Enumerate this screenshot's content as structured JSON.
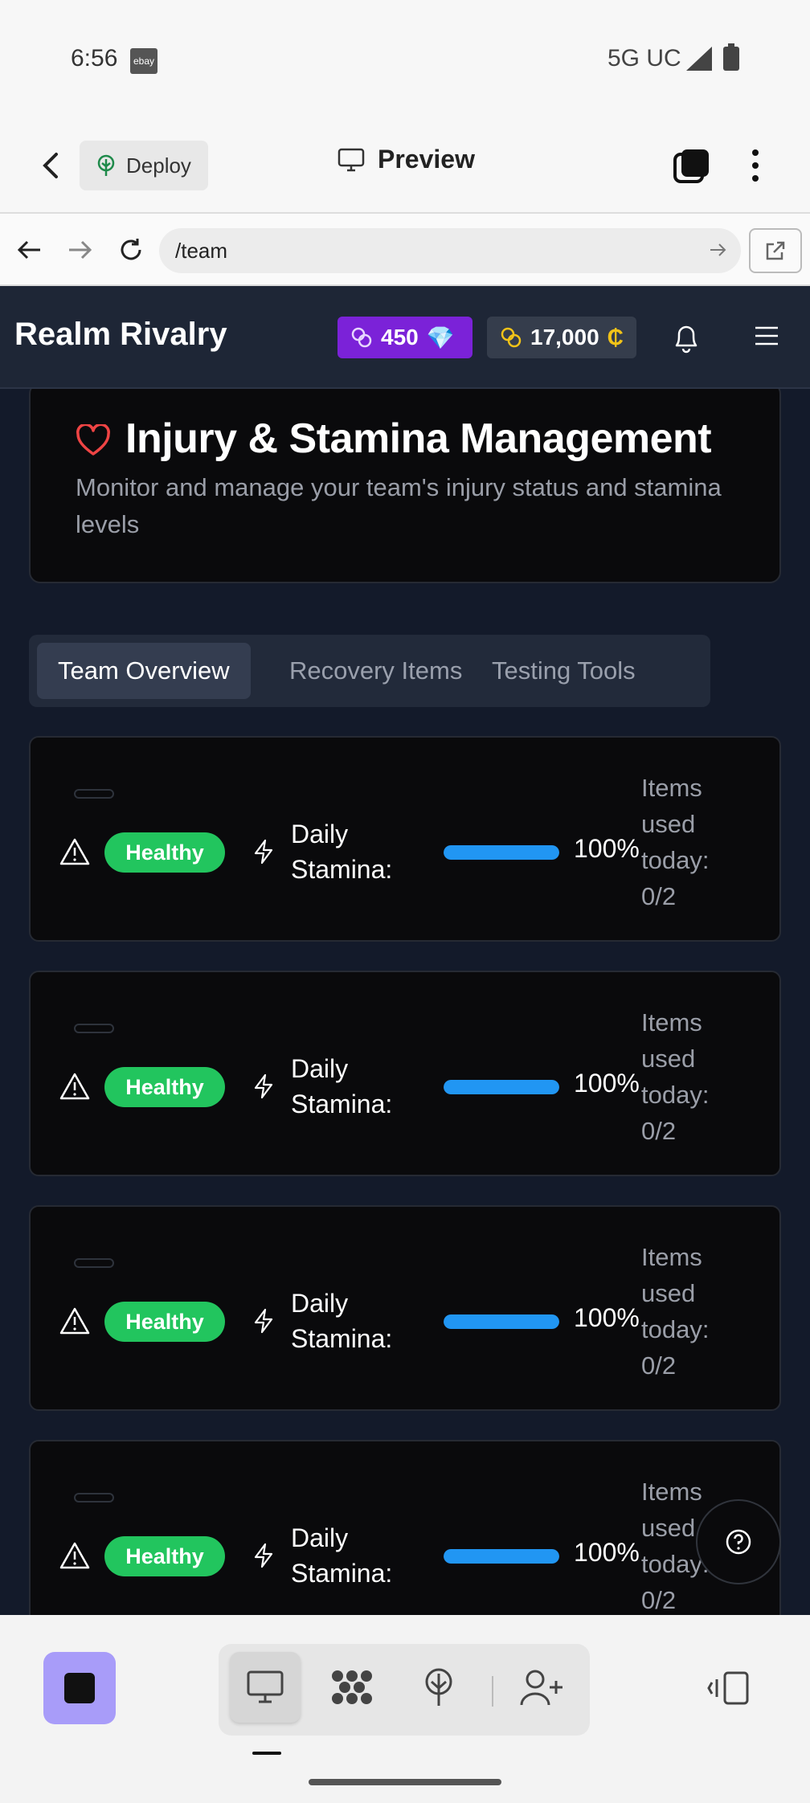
{
  "statusbar": {
    "time": "6:56",
    "app_badge": "ebay",
    "network": "5G UC"
  },
  "app_header": {
    "deploy_label": "Deploy",
    "preview_label": "Preview"
  },
  "url_bar": {
    "url": "/team"
  },
  "game": {
    "brand": "Realm Rivalry",
    "gems": "450",
    "gem_emoji": "💎",
    "credits": "17,000",
    "currency_symbol": "₵"
  },
  "hero": {
    "title": "Injury & Stamina Management",
    "subtitle": "Monitor and manage your team's injury status and stamina levels"
  },
  "tabs": [
    {
      "label": "Team Overview",
      "active": true
    },
    {
      "label": "Recovery Items",
      "active": false
    },
    {
      "label": "Testing Tools",
      "active": false
    }
  ],
  "players": [
    {
      "status": "Healthy",
      "stamina_label": "Daily Stamina:",
      "stamina": 1.0,
      "stamina_text": "100%",
      "items_used": "Items used today: 0/2"
    },
    {
      "status": "Healthy",
      "stamina_label": "Daily Stamina:",
      "stamina": 1.0,
      "stamina_text": "100%",
      "items_used": "Items used today: 0/2"
    },
    {
      "status": "Healthy",
      "stamina_label": "Daily Stamina:",
      "stamina": 1.0,
      "stamina_text": "100%",
      "items_used": "Items used today: 0/2"
    },
    {
      "status": "Healthy",
      "stamina_label": "Daily Stamina:",
      "stamina": 1.0,
      "stamina_text": "100%",
      "items_used": "Items used today: 0/2"
    }
  ],
  "colors": {
    "healthy": "#22c55e",
    "stamina_bar": "#2196f3",
    "gems_bg": "#7b22d8",
    "accent_stop": "#a89cf9",
    "heart": "#ef4444"
  },
  "icons": [
    "back-icon",
    "deploy-icon",
    "monitor-icon",
    "tabs-icon",
    "more-icon",
    "arrow-left-icon",
    "arrow-right-icon",
    "reload-icon",
    "external-link-icon",
    "gem-coins-icon",
    "credit-coins-icon",
    "bell-icon",
    "menu-icon",
    "heart-icon",
    "warning-icon",
    "bolt-icon",
    "help-icon",
    "stop-icon",
    "desktop-icon",
    "workflow-icon",
    "deploy-tree-icon",
    "add-user-icon",
    "side-panel-icon"
  ]
}
